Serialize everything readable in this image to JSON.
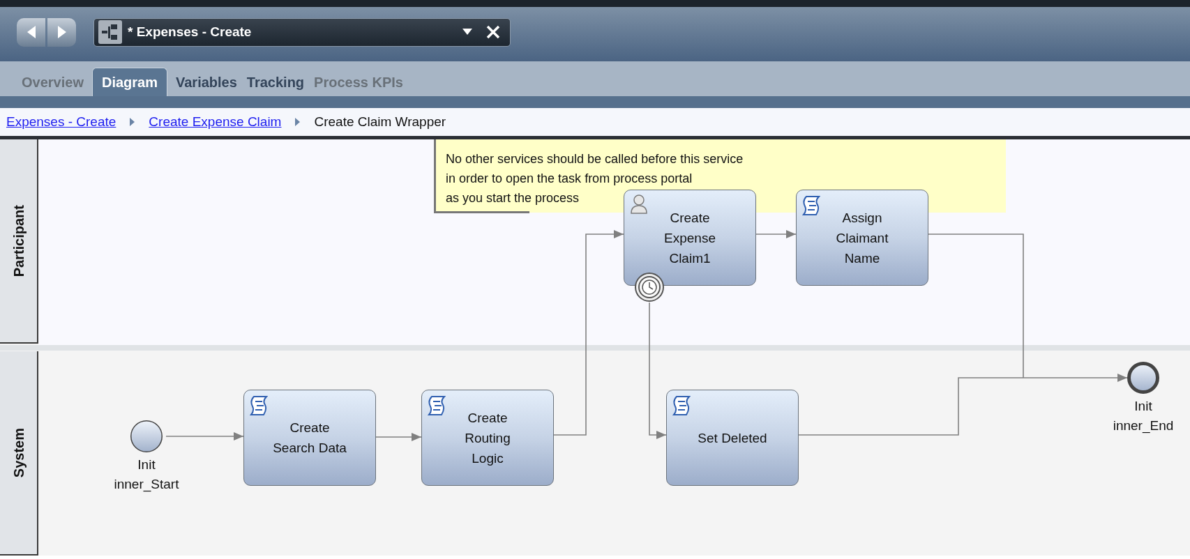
{
  "editor_tab": {
    "title": "* Expenses - Create"
  },
  "tabs": [
    {
      "label": "Overview",
      "selected": false,
      "disabled": true
    },
    {
      "label": "Diagram",
      "selected": true,
      "disabled": false
    },
    {
      "label": "Variables",
      "selected": false,
      "disabled": false
    },
    {
      "label": "Tracking",
      "selected": false,
      "disabled": false
    },
    {
      "label": "Process KPIs",
      "selected": false,
      "disabled": true
    }
  ],
  "breadcrumb": [
    {
      "label": "Expenses - Create",
      "kind": "link"
    },
    {
      "label": "Create Expense Claim",
      "kind": "link"
    },
    {
      "label": "Create Claim Wrapper",
      "kind": "current"
    }
  ],
  "lanes": [
    {
      "name": "Participant"
    },
    {
      "name": "System"
    }
  ],
  "note": {
    "lines": [
      "No other services should be called before this service",
      "in order to open the task from process portal",
      "as you start the process"
    ]
  },
  "tasks": [
    {
      "kind": "user",
      "lines": [
        "Create",
        "Expense",
        "Claim1"
      ],
      "timer_event": true
    },
    {
      "kind": "script",
      "lines": [
        "Assign",
        "Claimant",
        "Name"
      ],
      "timer_event": false
    },
    {
      "kind": "script",
      "lines": [
        "Create",
        "Search Data"
      ],
      "timer_event": false
    },
    {
      "kind": "script",
      "lines": [
        "Create",
        "Routing",
        "Logic"
      ],
      "timer_event": false
    },
    {
      "kind": "script",
      "lines": [
        "Set Deleted"
      ],
      "timer_event": false
    }
  ],
  "events": [
    {
      "kind": "start",
      "lines": [
        "Init",
        "inner_Start"
      ]
    },
    {
      "kind": "end",
      "lines": [
        "Init",
        "inner_End"
      ]
    }
  ]
}
